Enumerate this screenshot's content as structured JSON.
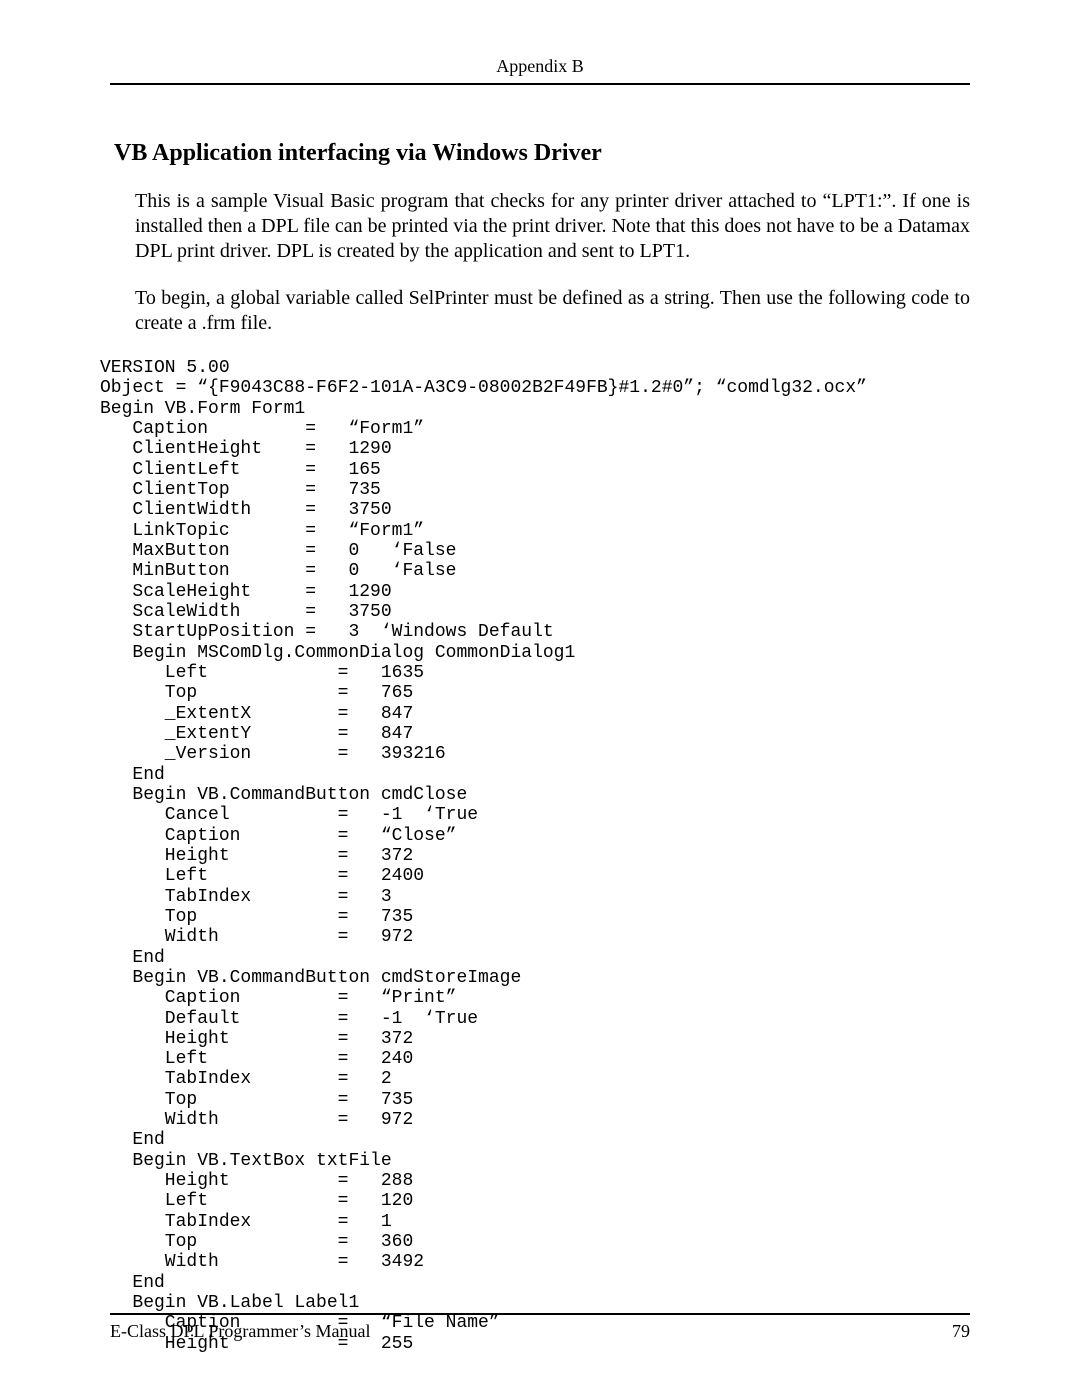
{
  "header": {
    "running_head": "Appendix B"
  },
  "section": {
    "title": "VB Application interfacing via Windows Driver",
    "para1": "This is a sample Visual Basic program that checks for any printer driver attached to “LPT1:”. If one is installed then a DPL file can be printed via the print driver. Note that this does not have to be a Datamax DPL print driver. DPL is created by the application and sent to LPT1.",
    "para2": "To begin, a global variable called SelPrinter must be defined as a string.  Then use the following code to create a .frm file."
  },
  "code": {
    "text": "VERSION 5.00\nObject = “{F9043C88-F6F2-101A-A3C9-08002B2F49FB}#1.2#0”; “comdlg32.ocx”\nBegin VB.Form Form1\n   Caption         =   “Form1”\n   ClientHeight    =   1290\n   ClientLeft      =   165\n   ClientTop       =   735\n   ClientWidth     =   3750\n   LinkTopic       =   “Form1”\n   MaxButton       =   0   ‘False\n   MinButton       =   0   ‘False\n   ScaleHeight     =   1290\n   ScaleWidth      =   3750\n   StartUpPosition =   3  ‘Windows Default\n   Begin MSComDlg.CommonDialog CommonDialog1\n      Left            =   1635\n      Top             =   765\n      _ExtentX        =   847\n      _ExtentY        =   847\n      _Version        =   393216\n   End\n   Begin VB.CommandButton cmdClose\n      Cancel          =   -1  ‘True\n      Caption         =   “Close”\n      Height          =   372\n      Left            =   2400\n      TabIndex        =   3\n      Top             =   735\n      Width           =   972\n   End\n   Begin VB.CommandButton cmdStoreImage\n      Caption         =   “Print”\n      Default         =   -1  ‘True\n      Height          =   372\n      Left            =   240\n      TabIndex        =   2\n      Top             =   735\n      Width           =   972\n   End\n   Begin VB.TextBox txtFile\n      Height          =   288\n      Left            =   120\n      TabIndex        =   1\n      Top             =   360\n      Width           =   3492\n   End\n   Begin VB.Label Label1\n      Caption         =   “File Name”\n      Height          =   255"
  },
  "footer": {
    "left": "E-Class DPL Programmer’s Manual",
    "right": "79"
  }
}
